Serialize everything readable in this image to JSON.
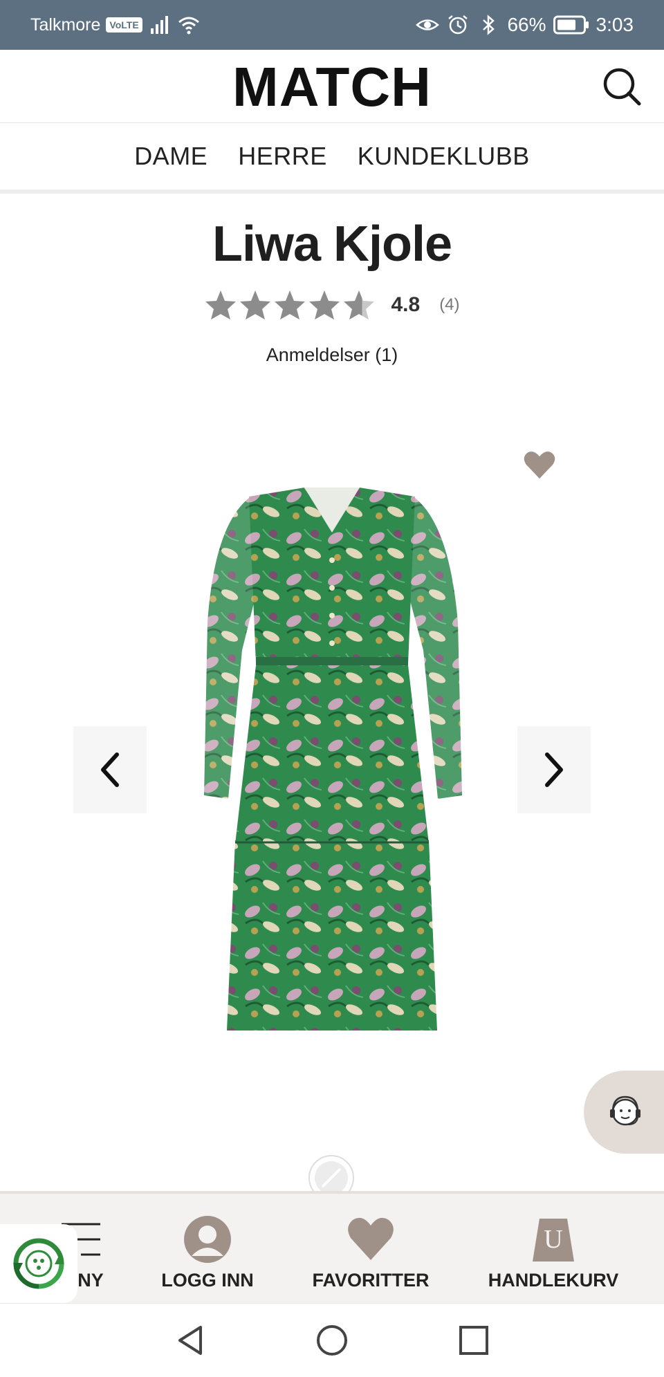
{
  "status_bar": {
    "carrier": "Talkmore",
    "volte": "VoLTE",
    "battery": "66%",
    "time": "3:03"
  },
  "header": {
    "logo": "MATCH",
    "search_icon": "search-icon"
  },
  "nav": {
    "items": [
      "DAME",
      "HERRE",
      "KUNDEKLUBB"
    ]
  },
  "product": {
    "title": "Liwa Kjole",
    "rating": 4.8,
    "rating_text": "4.8",
    "rating_count": "(4)",
    "reviews_link": "Anmeldelser (1)",
    "star_color": "#8c8c8c"
  },
  "gallery": {
    "prev_icon": "chevron-left-icon",
    "next_icon": "chevron-right-icon",
    "favorite_icon": "heart-icon"
  },
  "bottom_bar": {
    "menu_label": "NY",
    "login_label": "LOGG INN",
    "favorites_label": "FAVORITTER",
    "cart_label": "HANDLEKURV",
    "cart_icon_letter": "U",
    "accent": "#a09188"
  },
  "colors": {
    "status_bar": "#5d7082",
    "accent_taupe": "#a09188",
    "bottom_bar_bg": "#f4f2f0",
    "eco_green": "#2e8b3a"
  }
}
